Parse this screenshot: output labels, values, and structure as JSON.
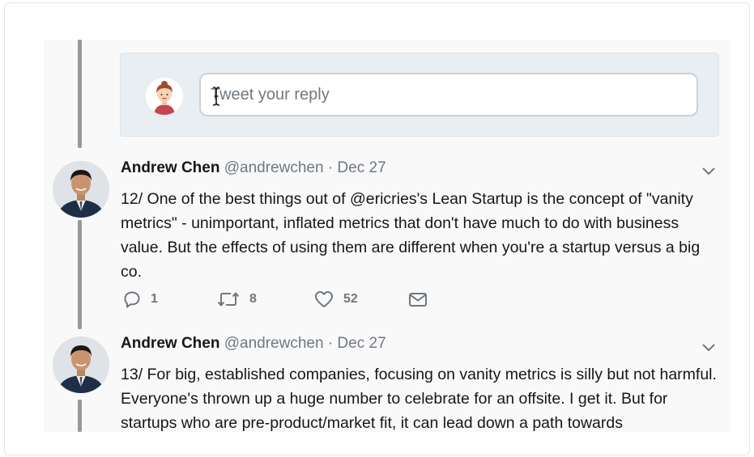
{
  "reply_box": {
    "placeholder": "Tweet your reply"
  },
  "tweets": [
    {
      "name": "Andrew Chen",
      "handle": "@andrewchen",
      "date": "· Dec 27",
      "text": "12/ One of the best things out of @ericries's Lean Startup is the concept of \"vanity metrics\" - unimportant, inflated metrics that don't have much to do with business value. But the effects of using them are different when you're a startup versus a big co.",
      "replies": "1",
      "retweets": "8",
      "likes": "52"
    },
    {
      "name": "Andrew Chen",
      "handle": "@andrewchen",
      "date": "· Dec 27",
      "text": "13/ For big, established companies, focusing on vanity metrics is silly but not harmful. Everyone's thrown up a huge number to celebrate for an offsite. I get it. But for startups who are pre-product/market fit, it can lead down a path towards"
    }
  ],
  "icons": {
    "reply": "reply-icon",
    "retweet": "retweet-icon",
    "like": "heart-icon",
    "message": "envelope-icon",
    "more": "chevron-down-icon"
  },
  "colors": {
    "text_primary": "#14171a",
    "text_secondary": "#6f7880",
    "thread_line": "#95999e",
    "reply_box_bg": "#e9eef3"
  }
}
